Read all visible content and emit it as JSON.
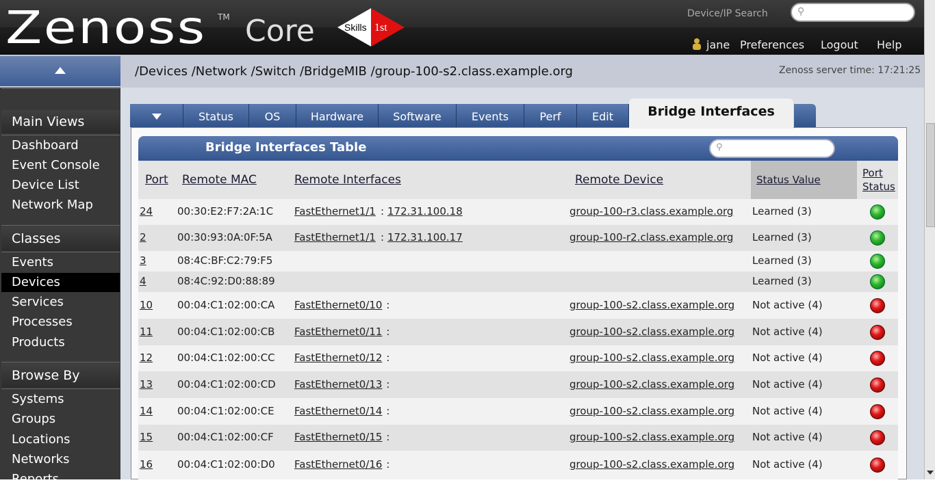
{
  "header": {
    "logo_text": "Zenoss",
    "logo_tm": "TM",
    "logo_core": "Core",
    "badge_left": "Skills",
    "badge_right": "1st",
    "search_label": "Device/IP Search",
    "search_placeholder": "",
    "user": "jane",
    "links": [
      "Preferences",
      "Logout",
      "Help"
    ]
  },
  "breadcrumb": {
    "path": "/Devices /Network /Switch /BridgeMIB /group-100-s2.class.example.org",
    "server_time": "Zenoss server time: 17:21:25"
  },
  "sidebar": {
    "sections": [
      {
        "title": "Main Views",
        "items": [
          "Dashboard",
          "Event Console",
          "Device List",
          "Network Map"
        ]
      },
      {
        "title": "Classes",
        "items": [
          "Events",
          "Devices",
          "Services",
          "Processes",
          "Products"
        ]
      },
      {
        "title": "Browse By",
        "items": [
          "Systems",
          "Groups",
          "Locations",
          "Networks",
          "Reports"
        ]
      }
    ],
    "selected": "Devices"
  },
  "tabs": {
    "items": [
      "Status",
      "OS",
      "Hardware",
      "Software",
      "Events",
      "Perf",
      "Edit"
    ],
    "active": "Bridge Interfaces"
  },
  "table": {
    "title": "Bridge Interfaces Table",
    "filter_placeholder": "",
    "columns": [
      "Port",
      "Remote MAC",
      "Remote Interfaces",
      "Remote Device",
      "Status Value",
      "Port",
      "Status"
    ],
    "rows": [
      {
        "port": "24",
        "mac": "00:30:E2:F7:2A:1C",
        "iface": "FastEthernet1/1",
        "ip": "172.31.100.18",
        "device": "group-100-r3.class.example.org",
        "status": "Learned (3)",
        "ok": true
      },
      {
        "port": "2",
        "mac": "00:30:93:0A:0F:5A",
        "iface": "FastEthernet1/1",
        "ip": "172.31.100.17",
        "device": "group-100-r2.class.example.org",
        "status": "Learned (3)",
        "ok": true
      },
      {
        "port": "3",
        "mac": "08:4C:BF:C2:79:F5",
        "iface": "",
        "ip": "",
        "device": "",
        "status": "Learned (3)",
        "ok": true
      },
      {
        "port": "4",
        "mac": "08:4C:92:D0:88:89",
        "iface": "",
        "ip": "",
        "device": "",
        "status": "Learned (3)",
        "ok": true
      },
      {
        "port": "10",
        "mac": "00:04:C1:02:00:CA",
        "iface": "FastEthernet0/10",
        "ip": "",
        "device": "group-100-s2.class.example.org",
        "status": "Not active (4)",
        "ok": false
      },
      {
        "port": "11",
        "mac": "00:04:C1:02:00:CB",
        "iface": "FastEthernet0/11",
        "ip": "",
        "device": "group-100-s2.class.example.org",
        "status": "Not active (4)",
        "ok": false
      },
      {
        "port": "12",
        "mac": "00:04:C1:02:00:CC",
        "iface": "FastEthernet0/12",
        "ip": "",
        "device": "group-100-s2.class.example.org",
        "status": "Not active (4)",
        "ok": false
      },
      {
        "port": "13",
        "mac": "00:04:C1:02:00:CD",
        "iface": "FastEthernet0/13",
        "ip": "",
        "device": "group-100-s2.class.example.org",
        "status": "Not active (4)",
        "ok": false
      },
      {
        "port": "14",
        "mac": "00:04:C1:02:00:CE",
        "iface": "FastEthernet0/14",
        "ip": "",
        "device": "group-100-s2.class.example.org",
        "status": "Not active (4)",
        "ok": false
      },
      {
        "port": "15",
        "mac": "00:04:C1:02:00:CF",
        "iface": "FastEthernet0/15",
        "ip": "",
        "device": "group-100-s2.class.example.org",
        "status": "Not active (4)",
        "ok": false
      },
      {
        "port": "16",
        "mac": "00:04:C1:02:00:D0",
        "iface": "FastEthernet0/16",
        "ip": "",
        "device": "group-100-s2.class.example.org",
        "status": "Not active (4)",
        "ok": false
      }
    ]
  },
  "colors": {
    "ok": "#2eb82e",
    "bad": "#e01818",
    "tab": "#3e5e96"
  },
  "icons": {
    "search": "search-icon",
    "user": "user-icon",
    "collapse": "collapse-up-icon",
    "menu": "menu-down-icon",
    "status": "status-dot-icon"
  }
}
